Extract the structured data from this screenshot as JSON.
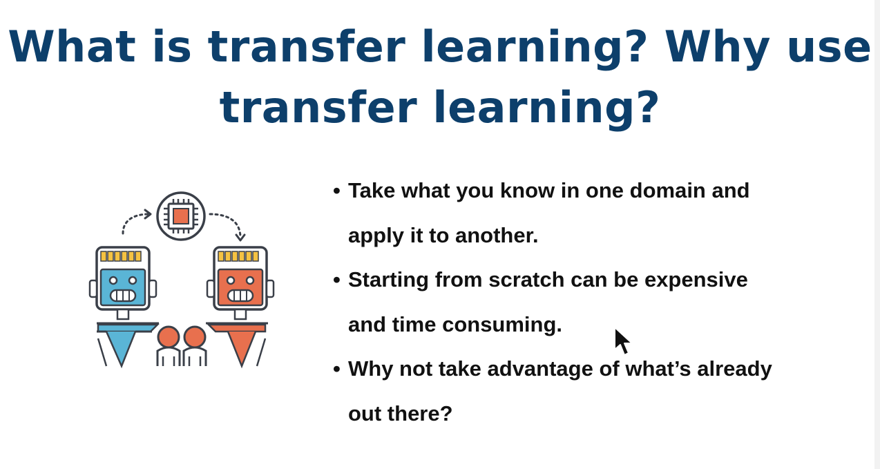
{
  "slide": {
    "title_line1": "What is transfer learning? Why use",
    "title_line2": "transfer learning?",
    "bullets": [
      {
        "line1": "Take what you know in one domain and",
        "line2": "apply it to another."
      },
      {
        "line1": "Starting from scratch can be expensive",
        "line2": "and time consuming."
      },
      {
        "line1": "Why not take advantage of what’s already",
        "line2": "out there?"
      }
    ]
  },
  "illustration": {
    "icons": [
      "chip-icon",
      "left-robot-icon",
      "right-robot-icon",
      "person-icon",
      "transfer-arrow-icon"
    ],
    "colors": {
      "outline": "#3a3f48",
      "blue": "#5ab5d6",
      "orange": "#e8704e",
      "yellow": "#f5c242",
      "title": "#0d3f6b"
    }
  },
  "cursor": {
    "icon": "mouse-pointer-icon"
  }
}
